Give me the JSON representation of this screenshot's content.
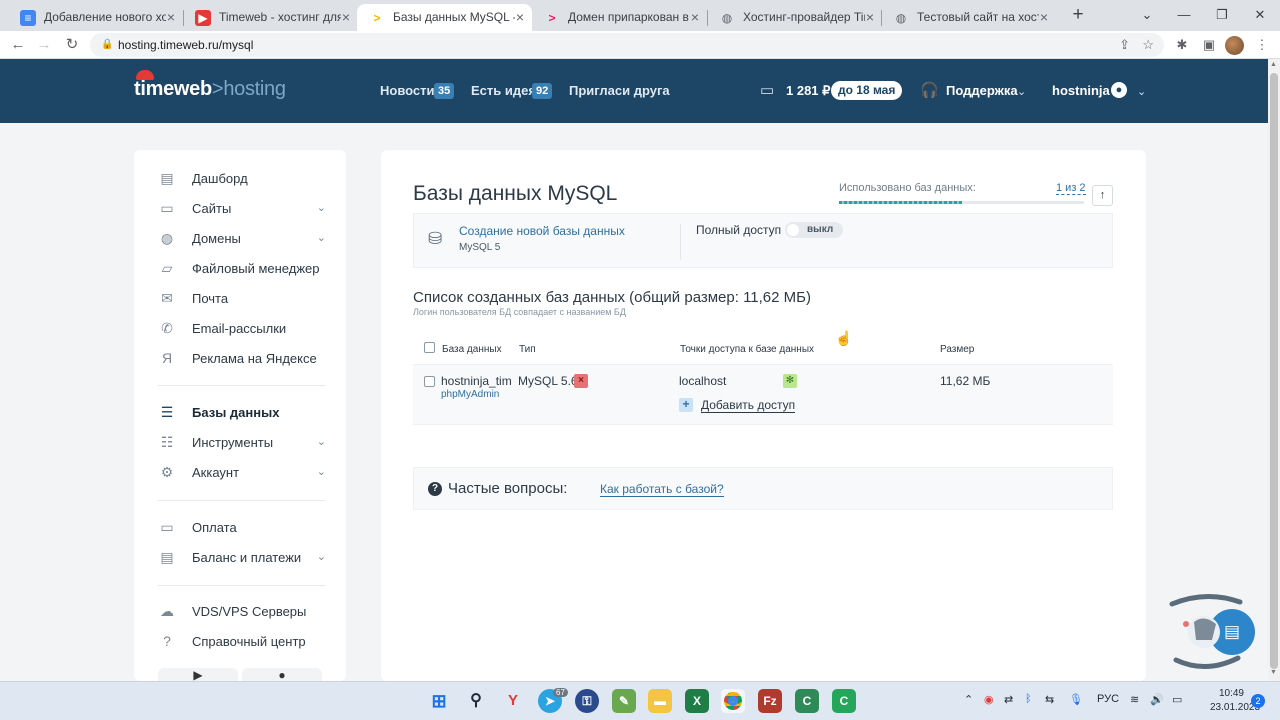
{
  "browser": {
    "tabs": [
      {
        "title": "Добавление нового хостер",
        "favicon": "docs-icon",
        "color": "#4285f4"
      },
      {
        "title": "Timeweb - хостинг для сай",
        "favicon": "youtube-icon",
        "color": "#e53935"
      },
      {
        "title": "Базы данных MySQL - Хос",
        "favicon": "timeweb-icon",
        "color": "#f4b400"
      },
      {
        "title": "Домен припаркован в Tim",
        "favicon": "timeweb-icon",
        "color": "#e91e63"
      },
      {
        "title": "Хостинг-провайдер TimeW",
        "favicon": "globe-icon",
        "color": "#5f6368"
      },
      {
        "title": "Тестовый сайт на хостинге",
        "favicon": "globe-icon",
        "color": "#5f6368"
      }
    ],
    "active_tab": 2,
    "url": "hosting.timeweb.ru/mysql"
  },
  "header": {
    "logo_main": "timeweb",
    "logo_sep": ">",
    "logo_sub": "hosting",
    "news_label": "Новости",
    "news_count": "35",
    "idea_label": "Есть идея",
    "idea_count": "92",
    "invite_label": "Пригласи друга",
    "balance": "1 281 ₽",
    "until": "до 18 мая",
    "support": "Поддержка",
    "username": "hostninja"
  },
  "sidebar": {
    "items": [
      {
        "label": "Дашборд",
        "icon": "dashboard-icon"
      },
      {
        "label": "Сайты",
        "icon": "monitor-icon"
      },
      {
        "label": "Домены",
        "icon": "globe-icon"
      },
      {
        "label": "Файловый менеджер",
        "icon": "folder-icon"
      },
      {
        "label": "Почта",
        "icon": "mail-icon"
      },
      {
        "label": "Email-рассылки",
        "icon": "mailing-icon"
      },
      {
        "label": "Реклама на Яндексе",
        "icon": "yandex-icon"
      },
      {
        "label": "Базы данных",
        "icon": "database-icon"
      },
      {
        "label": "Инструменты",
        "icon": "sliders-icon"
      },
      {
        "label": "Аккаунт",
        "icon": "gear-icon"
      },
      {
        "label": "Оплата",
        "icon": "card-icon"
      },
      {
        "label": "Баланс и платежи",
        "icon": "wallet-icon"
      },
      {
        "label": "VDS/VPS Серверы",
        "icon": "cloud-icon"
      },
      {
        "label": "Справочный центр",
        "icon": "help-icon"
      }
    ]
  },
  "main": {
    "title": "Базы данных MySQL",
    "used_label": "Использовано баз данных:",
    "used_value": "1 из 2",
    "used_fraction": 0.5,
    "create_link": "Создание новой базы данных",
    "create_sub": "MySQL 5",
    "full_access_label": "Полный доступ",
    "full_access_state": "выкл",
    "list_title": "Список созданных баз данных (общий размер: 11,62 МБ)",
    "list_note": "Логин пользователя БД совпадает с названием БД",
    "columns": [
      "База данных",
      "Тип",
      "Точки доступа к базе данных",
      "Размер"
    ],
    "rows": [
      {
        "name": "hostninja_tim",
        "admin_link": "phpMyAdmin",
        "type": "MySQL 5.6",
        "access": "localhost",
        "add_access": "Добавить доступ",
        "size": "11,62 МБ"
      }
    ],
    "faq_label": "Частые вопросы:",
    "faq_link": "Как работать с базой?"
  },
  "taskbar": {
    "lang": "РУС",
    "time": "10:49",
    "date": "23.01.2023",
    "notifications": "2",
    "telegram_badge": "67"
  }
}
